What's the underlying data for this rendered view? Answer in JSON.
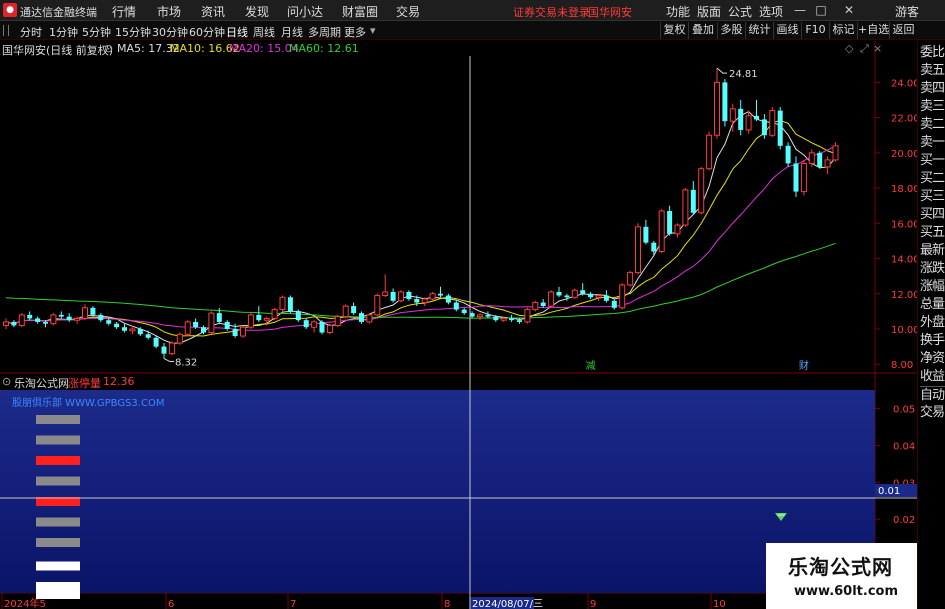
{
  "menubar": {
    "app_name": "通达信金融终端",
    "menus": [
      "行情",
      "市场",
      "资讯",
      "发现",
      "问小达",
      "财富圈",
      "交易"
    ],
    "warning": "证券交易未登录",
    "stock_name": "国华网安",
    "right_menus": [
      "功能",
      "版面",
      "公式",
      "选项"
    ],
    "window_buttons": [
      "—",
      "□",
      "✕"
    ],
    "guest": "游客"
  },
  "periodbar": {
    "periods": [
      "分时",
      "1分钟",
      "5分钟",
      "15分钟",
      "30分钟",
      "60分钟",
      "日线",
      "周线",
      "月线",
      "多周期",
      "更多"
    ],
    "active_period": "日线",
    "tools": [
      "复权",
      "叠加",
      "多股",
      "统计",
      "画线",
      "F10",
      "标记",
      "+自选",
      "返回"
    ]
  },
  "info": {
    "title": "国华网安(日线 前复权)",
    "ma5": "MA5: 17.32",
    "ma10": "MA10: 16.62",
    "ma20": "MA20: 15.04",
    "ma60": "MA60: 12.61"
  },
  "sidepanel": {
    "items": [
      "委比",
      "卖五",
      "卖四",
      "卖三",
      "卖二",
      "卖一",
      "买一",
      "买二",
      "买三",
      "买四",
      "买五",
      "最新",
      "涨跌",
      "涨幅",
      "总量",
      "外盘",
      "换手",
      "净资",
      "收益",
      "自动",
      "交易"
    ]
  },
  "indicator": {
    "name": "乐淘公式网",
    "label": "涨停量",
    "value": "12.36",
    "url": "股朋俱乐部 WWW.GPBGS3.COM",
    "cursor_value": "0.01"
  },
  "chart_data": [
    {
      "type": "candlestick",
      "title": "国华网安(日线 前复权)",
      "ylim": [
        7.5,
        25.5
      ],
      "y_ticks": [
        8.0,
        10.0,
        12.0,
        14.0,
        16.0,
        18.0,
        20.0,
        22.0,
        24.0
      ],
      "x_ticks": [
        "2024年5",
        "6",
        "7",
        "8",
        "2024/08/07/三",
        "9",
        "10"
      ],
      "annotations": [
        {
          "text": "24.81",
          "kind": "max"
        },
        {
          "text": "8.32",
          "kind": "min"
        },
        {
          "text": "减",
          "kind": "event"
        },
        {
          "text": "财",
          "kind": "event"
        }
      ],
      "candles": [
        [
          10.2,
          10.6,
          10.0,
          10.4
        ],
        [
          10.4,
          10.5,
          10.1,
          10.2
        ],
        [
          10.2,
          10.9,
          10.1,
          10.8
        ],
        [
          10.8,
          11.0,
          10.5,
          10.6
        ],
        [
          10.6,
          10.7,
          10.3,
          10.4
        ],
        [
          10.4,
          10.5,
          10.1,
          10.3
        ],
        [
          10.3,
          10.9,
          10.2,
          10.8
        ],
        [
          10.8,
          11.0,
          10.6,
          10.7
        ],
        [
          10.7,
          10.9,
          10.4,
          10.5
        ],
        [
          10.5,
          10.7,
          10.3,
          10.6
        ],
        [
          10.6,
          11.4,
          10.5,
          11.2
        ],
        [
          11.2,
          11.3,
          10.7,
          10.8
        ],
        [
          10.8,
          10.9,
          10.4,
          10.5
        ],
        [
          10.5,
          10.6,
          10.2,
          10.3
        ],
        [
          10.3,
          10.4,
          10.0,
          10.1
        ],
        [
          10.1,
          10.3,
          9.8,
          9.9
        ],
        [
          9.9,
          10.2,
          9.7,
          10.0
        ],
        [
          10.0,
          10.1,
          9.6,
          9.7
        ],
        [
          9.7,
          9.9,
          9.4,
          9.5
        ],
        [
          9.5,
          9.6,
          8.9,
          9.0
        ],
        [
          9.0,
          9.2,
          8.32,
          8.6
        ],
        [
          8.6,
          9.3,
          8.5,
          9.2
        ],
        [
          9.2,
          9.8,
          9.1,
          9.7
        ],
        [
          9.7,
          10.5,
          9.6,
          10.4
        ],
        [
          10.4,
          10.6,
          10.0,
          10.1
        ],
        [
          10.1,
          10.2,
          9.7,
          9.8
        ],
        [
          9.8,
          11.0,
          9.7,
          10.9
        ],
        [
          10.9,
          11.2,
          10.3,
          10.4
        ],
        [
          10.4,
          10.5,
          9.9,
          10.0
        ],
        [
          10.0,
          10.3,
          9.5,
          9.6
        ],
        [
          9.6,
          10.2,
          9.5,
          10.1
        ],
        [
          10.1,
          10.9,
          10.0,
          10.8
        ],
        [
          10.8,
          11.3,
          10.4,
          10.5
        ],
        [
          10.5,
          10.7,
          10.2,
          10.6
        ],
        [
          10.6,
          11.2,
          10.5,
          11.1
        ],
        [
          11.1,
          11.9,
          11.0,
          11.8
        ],
        [
          11.8,
          11.9,
          10.9,
          11.0
        ],
        [
          11.0,
          11.1,
          10.4,
          10.5
        ],
        [
          10.5,
          10.6,
          10.0,
          10.1
        ],
        [
          10.1,
          10.5,
          9.8,
          10.4
        ],
        [
          10.4,
          10.5,
          9.7,
          9.8
        ],
        [
          9.8,
          10.3,
          9.7,
          10.2
        ],
        [
          10.2,
          10.8,
          10.1,
          10.7
        ],
        [
          10.7,
          11.4,
          10.6,
          11.3
        ],
        [
          11.3,
          11.5,
          10.8,
          10.9
        ],
        [
          10.9,
          11.0,
          10.3,
          10.4
        ],
        [
          10.4,
          10.9,
          10.3,
          10.8
        ],
        [
          10.8,
          12.0,
          10.7,
          11.9
        ],
        [
          11.9,
          13.1,
          11.8,
          12.1
        ],
        [
          12.1,
          12.3,
          11.5,
          11.6
        ],
        [
          11.6,
          12.2,
          11.5,
          12.1
        ],
        [
          12.1,
          12.2,
          11.6,
          11.7
        ],
        [
          11.7,
          11.9,
          11.3,
          11.5
        ],
        [
          11.5,
          11.8,
          11.3,
          11.7
        ],
        [
          11.7,
          12.1,
          11.6,
          12.0
        ],
        [
          12.0,
          12.4,
          11.8,
          11.9
        ],
        [
          11.9,
          12.0,
          11.4,
          11.5
        ],
        [
          11.5,
          11.6,
          11.0,
          11.1
        ],
        [
          11.1,
          11.2,
          10.8,
          10.9
        ],
        [
          10.9,
          11.0,
          10.6,
          10.7
        ],
        [
          10.7,
          10.9,
          10.5,
          10.8
        ],
        [
          10.8,
          11.0,
          10.6,
          10.7
        ],
        [
          10.7,
          10.8,
          10.4,
          10.5
        ],
        [
          10.5,
          10.7,
          10.4,
          10.6
        ],
        [
          10.6,
          10.8,
          10.4,
          10.5
        ],
        [
          10.5,
          10.6,
          10.3,
          10.4
        ],
        [
          10.4,
          11.2,
          10.3,
          11.1
        ],
        [
          11.1,
          11.6,
          11.0,
          11.5
        ],
        [
          11.5,
          11.7,
          11.2,
          11.3
        ],
        [
          11.3,
          12.2,
          11.2,
          12.1
        ],
        [
          12.1,
          12.4,
          11.8,
          11.9
        ],
        [
          11.9,
          12.0,
          11.6,
          11.8
        ],
        [
          11.8,
          12.3,
          11.7,
          12.2
        ],
        [
          12.2,
          12.6,
          11.9,
          12.0
        ],
        [
          12.0,
          12.1,
          11.7,
          11.8
        ],
        [
          11.8,
          12.0,
          11.6,
          11.9
        ],
        [
          11.9,
          12.2,
          11.5,
          11.6
        ],
        [
          11.6,
          11.7,
          11.1,
          11.2
        ],
        [
          11.2,
          12.6,
          11.1,
          12.5
        ],
        [
          12.5,
          13.3,
          12.4,
          13.2
        ],
        [
          13.2,
          16.0,
          13.1,
          15.8
        ],
        [
          15.8,
          16.2,
          14.8,
          14.9
        ],
        [
          14.9,
          15.0,
          14.2,
          14.4
        ],
        [
          14.4,
          16.8,
          14.3,
          16.7
        ],
        [
          16.7,
          17.0,
          15.3,
          15.4
        ],
        [
          15.4,
          16.0,
          15.2,
          15.9
        ],
        [
          15.9,
          18.0,
          15.8,
          17.9
        ],
        [
          17.9,
          18.4,
          16.5,
          16.6
        ],
        [
          16.6,
          19.2,
          16.5,
          19.1
        ],
        [
          19.1,
          21.2,
          19.0,
          21.0
        ],
        [
          21.0,
          24.81,
          20.8,
          24.0
        ],
        [
          24.0,
          24.2,
          21.5,
          21.8
        ],
        [
          21.8,
          22.8,
          21.2,
          22.5
        ],
        [
          22.5,
          23.0,
          21.0,
          21.3
        ],
        [
          21.3,
          22.4,
          21.1,
          22.1
        ],
        [
          22.1,
          23.0,
          21.8,
          21.9
        ],
        [
          21.9,
          22.2,
          20.8,
          21.0
        ],
        [
          21.0,
          22.6,
          20.9,
          22.4
        ],
        [
          22.4,
          22.6,
          20.2,
          20.4
        ],
        [
          20.4,
          20.6,
          19.2,
          19.4
        ],
        [
          19.4,
          19.8,
          17.5,
          17.8
        ],
        [
          17.8,
          19.6,
          17.6,
          19.4
        ],
        [
          19.4,
          20.2,
          19.2,
          20.0
        ],
        [
          20.0,
          20.1,
          19.1,
          19.2
        ],
        [
          19.2,
          19.8,
          18.8,
          19.6
        ],
        [
          19.6,
          20.6,
          19.5,
          20.4
        ]
      ]
    },
    {
      "type": "bar",
      "title": "涨停量",
      "ylim": [
        0.0,
        0.055
      ],
      "y_ticks": [
        0.0,
        0.01,
        0.02,
        0.03,
        0.04,
        0.05
      ],
      "colors": [
        "#8a8a8a",
        "#8a8a8a",
        "#ff2020",
        "#8a8a8a",
        "#ff2020",
        "#8a8a8a",
        "#8a8a8a",
        "#ffffff",
        "#ffffff"
      ]
    }
  ]
}
